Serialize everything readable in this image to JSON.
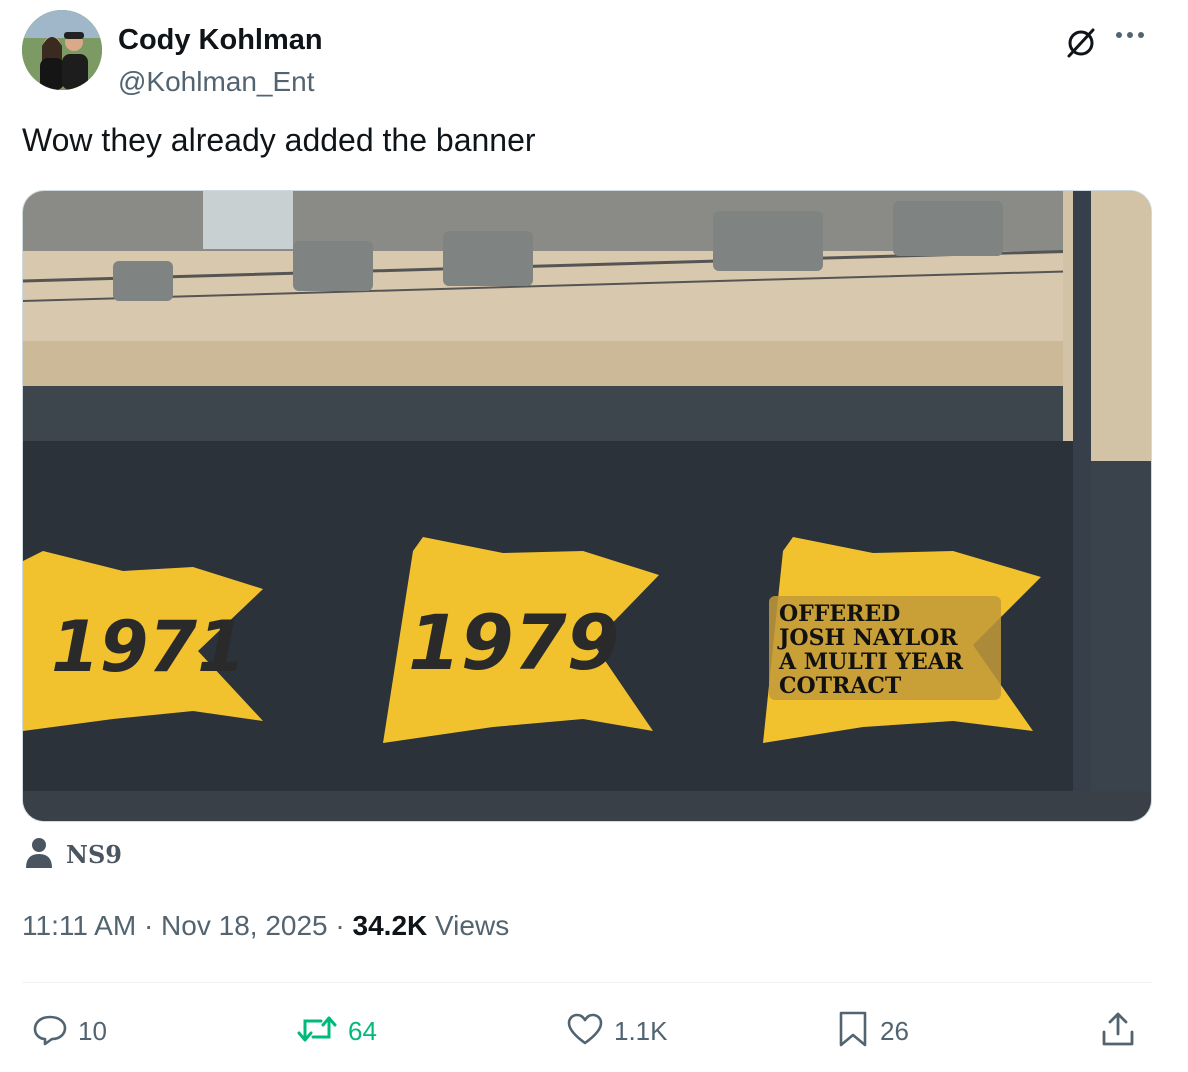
{
  "author": {
    "display_name": "Cody Kohlman",
    "handle": "@Kohlman_Ent"
  },
  "tweet": {
    "text": "Wow they already added the banner"
  },
  "media": {
    "banners": [
      "1971",
      "1979"
    ],
    "overlay_lines": [
      "OFFERED",
      "JOSH NAYLOR",
      "A MULTI YEAR",
      "COTRACT"
    ],
    "banner_color": "#f2c22e",
    "wall_color": "#2b323a",
    "credit": "NS9"
  },
  "meta": {
    "time": "11:11 AM",
    "separator": "·",
    "date": "Nov 18, 2025",
    "views_count": "34.2K",
    "views_label": "Views"
  },
  "actions": {
    "replies": "10",
    "retweets": "64",
    "likes": "1.1K",
    "bookmarks": "26"
  },
  "icons": {
    "reply": "reply-icon",
    "retweet": "retweet-icon",
    "like": "heart-icon",
    "bookmark": "bookmark-icon",
    "share": "share-icon",
    "more": "more-icon",
    "grok": "grok-icon",
    "credit": "person-icon"
  },
  "colors": {
    "retweet_accent": "#00ba7c",
    "secondary_text": "#536471"
  }
}
